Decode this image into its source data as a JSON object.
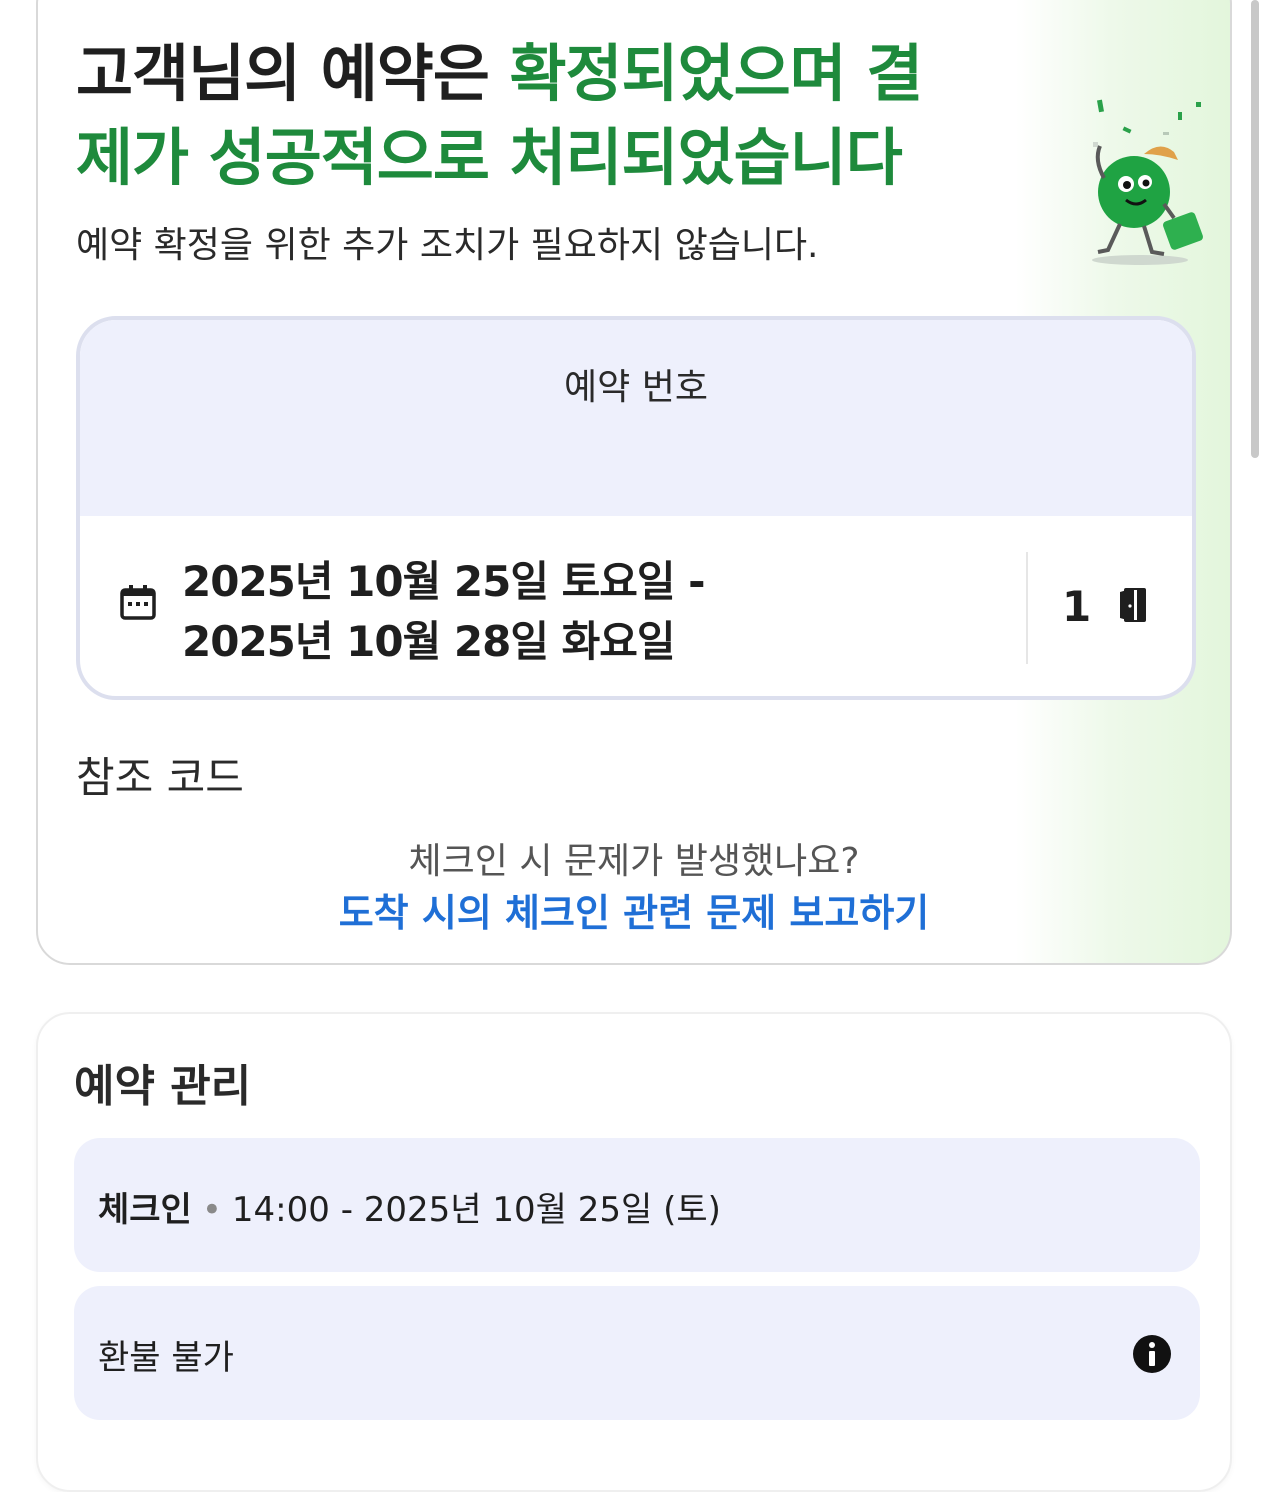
{
  "confirmation": {
    "headline_dark": "고객님의 예약은 ",
    "headline_green_1": "확정되었으며 결",
    "headline_green_2": "제가 성공적으로 처리되었습니다",
    "subtext": "예약 확정을 위한 추가 조치가 필요하지 않습니다."
  },
  "booking": {
    "number_label": "예약 번호",
    "date_line_1": "2025년 10월 25일 토요일 -",
    "date_line_2": "2025년 10월 28일 화요일",
    "room_count": "1"
  },
  "reference": {
    "label": "참조 코드"
  },
  "checkin_issue": {
    "question": "체크인 시 문제가 발생했나요?",
    "link": "도착 시의 체크인 관련 문제 보고하기"
  },
  "manage": {
    "title": "예약 관리",
    "checkin_label": "체크인",
    "checkin_value": "14:00 - 2025년 10월 25일 (토)",
    "refund_label": "환불 불가"
  },
  "colors": {
    "green": "#1e8a3c",
    "link_blue": "#1f6fd6",
    "panel_lavender": "#eef0fc"
  },
  "icons": [
    "mascot-illustration",
    "calendar-icon",
    "door-icon",
    "info-icon"
  ]
}
